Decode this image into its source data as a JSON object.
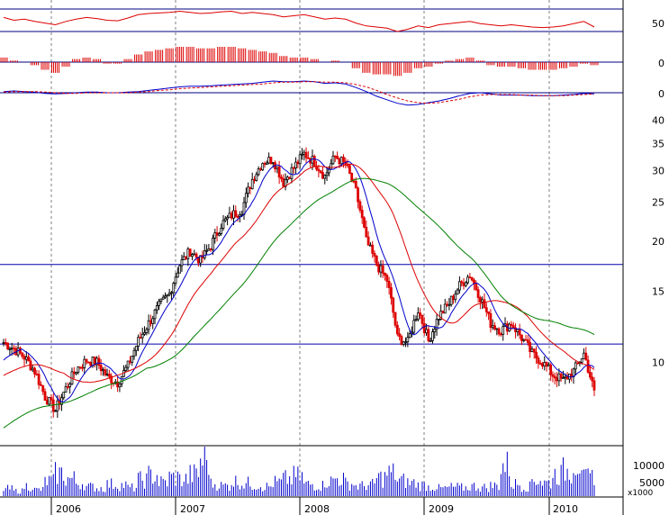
{
  "chart_data": {
    "type": "candlestick",
    "title": "",
    "x_labels": [
      "2006",
      "2007",
      "2008",
      "2009",
      "2010"
    ],
    "colors": {
      "up": "#000000",
      "down": "#dd0000",
      "ma_short": "#0000cc",
      "ma_mid": "#dd0000",
      "ma_long": "#008000",
      "hline": "#0000aa",
      "volume": "#0000cc",
      "grid": "#808080"
    },
    "price_panel": {
      "scale": "log",
      "ylim": [
        6.2,
        44
      ],
      "tick_labels": [
        "40",
        "35",
        "30",
        "25",
        "20",
        "15",
        "10"
      ],
      "tick_values": [
        40,
        35,
        30,
        25,
        20,
        15,
        10
      ],
      "hlines": [
        17.5,
        11.1
      ],
      "moving_averages": [
        {
          "name": "MA short",
          "color": "#0000cc"
        },
        {
          "name": "MA mid",
          "color": "#dd0000"
        },
        {
          "name": "MA long",
          "color": "#008000"
        }
      ],
      "closes": [
        11.2,
        10.8,
        10.3,
        9.5,
        8.2,
        7.6,
        8.6,
        9.6,
        10.1,
        10.0,
        9.2,
        8.9,
        9.8,
        11.3,
        12.5,
        13.8,
        14.8,
        17.5,
        18.9,
        17.9,
        19.5,
        22.0,
        23.2,
        24.0,
        28.5,
        31.5,
        32.0,
        28.0,
        30.5,
        33.0,
        31.5,
        29.0,
        32.5,
        31.0,
        26.5,
        20.0,
        17.5,
        16.0,
        11.5,
        11.2,
        13.5,
        11.3,
        13.0,
        14.0,
        15.5,
        16.5,
        14.5,
        12.5,
        12.0,
        12.5,
        11.5,
        10.5,
        10.0,
        9.3,
        9.0,
        9.5,
        10.5,
        8.4
      ]
    },
    "rsi_panel": {
      "tick_labels": [
        "50"
      ],
      "tick_values": [
        50
      ],
      "hlines": [
        70,
        30
      ],
      "values": [
        55,
        50,
        52,
        48,
        45,
        42,
        48,
        52,
        55,
        53,
        50,
        49,
        54,
        60,
        62,
        63,
        64,
        66,
        64,
        62,
        63,
        65,
        66,
        62,
        64,
        62,
        60,
        56,
        58,
        60,
        56,
        52,
        54,
        52,
        45,
        40,
        38,
        36,
        30,
        34,
        40,
        37,
        42,
        44,
        46,
        48,
        44,
        42,
        40,
        42,
        40,
        38,
        37,
        38,
        40,
        44,
        48,
        38
      ]
    },
    "histogram_panel": {
      "tick_labels": [
        "0"
      ],
      "tick_values": [
        0
      ],
      "values": [
        0.3,
        0.1,
        0,
        -0.2,
        -0.5,
        -0.7,
        -0.3,
        0.2,
        0.3,
        0.2,
        -0.1,
        -0.1,
        0.2,
        0.5,
        0.7,
        0.8,
        0.9,
        1.0,
        1.0,
        0.9,
        0.9,
        1.0,
        1.0,
        0.9,
        0.8,
        0.7,
        0.6,
        0.4,
        0.3,
        0.3,
        0.2,
        0.0,
        0.1,
        0.0,
        -0.4,
        -0.7,
        -0.8,
        -0.8,
        -0.9,
        -0.7,
        -0.4,
        -0.3,
        -0.1,
        0.1,
        0.2,
        0.3,
        0.1,
        -0.2,
        -0.3,
        -0.3,
        -0.4,
        -0.5,
        -0.5,
        -0.5,
        -0.4,
        -0.3,
        -0.1,
        -0.2
      ]
    },
    "macd_panel": {
      "tick_labels": [
        "0"
      ],
      "tick_values": [
        0
      ],
      "macd": [
        0.2,
        0.3,
        0.2,
        0.1,
        -0.1,
        -0.2,
        -0.1,
        0.0,
        0.1,
        0.1,
        0.0,
        0.0,
        0.1,
        0.2,
        0.4,
        0.6,
        0.8,
        1.0,
        1.1,
        1.1,
        1.2,
        1.3,
        1.4,
        1.5,
        1.6,
        1.8,
        2.0,
        1.9,
        1.9,
        2.0,
        1.9,
        1.6,
        1.7,
        1.5,
        0.9,
        0.2,
        -0.6,
        -1.2,
        -1.8,
        -2.1,
        -2.0,
        -1.7,
        -1.4,
        -1.0,
        -0.5,
        -0.1,
        0.0,
        -0.2,
        -0.4,
        -0.4,
        -0.4,
        -0.5,
        -0.5,
        -0.5,
        -0.4,
        -0.3,
        -0.1,
        -0.2
      ],
      "signal": [
        0.1,
        0.2,
        0.2,
        0.2,
        0.1,
        0.0,
        -0.1,
        -0.1,
        0.0,
        0.0,
        0.0,
        0.0,
        0.0,
        0.1,
        0.2,
        0.4,
        0.5,
        0.7,
        0.8,
        0.9,
        1.0,
        1.1,
        1.2,
        1.3,
        1.4,
        1.5,
        1.7,
        1.8,
        1.8,
        1.9,
        1.9,
        1.8,
        1.8,
        1.7,
        1.4,
        1.0,
        0.4,
        -0.3,
        -0.9,
        -1.4,
        -1.7,
        -1.8,
        -1.7,
        -1.4,
        -1.1,
        -0.7,
        -0.4,
        -0.3,
        -0.3,
        -0.3,
        -0.4,
        -0.4,
        -0.5,
        -0.5,
        -0.5,
        -0.4,
        -0.3,
        -0.2
      ]
    },
    "volume_panel": {
      "tick_labels": [
        "10000",
        "5000"
      ],
      "tick_values": [
        10000,
        5000
      ],
      "multiplier_label": "x1000",
      "ylim": [
        0,
        13500
      ],
      "values": [
        2500,
        1800,
        3500,
        2200,
        5200,
        7800,
        6000,
        4500,
        3200,
        2800,
        4100,
        3800,
        2900,
        5600,
        7200,
        4800,
        6500,
        5800,
        7400,
        12500,
        4200,
        3600,
        5100,
        4400,
        3900,
        3300,
        4700,
        5900,
        6800,
        4100,
        3700,
        5200,
        6100,
        4300,
        3500,
        3900,
        6400,
        7900,
        5300,
        4600,
        3800,
        3200,
        2700,
        3100,
        2900,
        3400,
        3000,
        3600,
        10500,
        4200,
        3300,
        5800,
        4700,
        7600,
        8800,
        12000,
        6200,
        3100
      ]
    }
  }
}
